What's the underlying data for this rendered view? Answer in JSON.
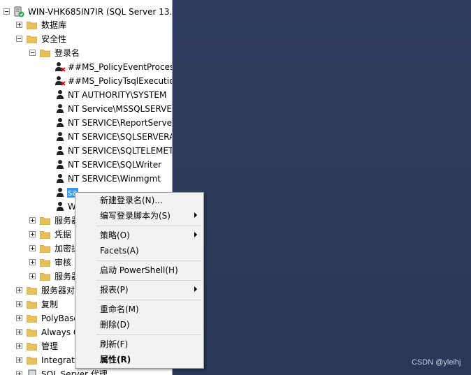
{
  "tree": {
    "server_label": "WIN-VHK685IN7IR (SQL Server 13.",
    "nodes": {
      "databases": "数据库",
      "security": "安全性",
      "logins": "登录名",
      "server_roles": "服务器",
      "credentials": "凭据",
      "crypto": "加密提",
      "audits": "审核",
      "server_audit_specs": "服务器",
      "server_objects": "服务器对",
      "replication": "复制",
      "polybase": "PolyBase",
      "always_on": "Always C",
      "management": "管理",
      "integration": "Integratio",
      "sql_agent": "SQL Server 代理"
    },
    "logins": [
      {
        "name": "##MS_PolicyEventProcess",
        "disabled": true
      },
      {
        "name": "##MS_PolicyTsqlExecution",
        "disabled": true
      },
      {
        "name": "NT AUTHORITY\\SYSTEM",
        "disabled": false
      },
      {
        "name": "NT Service\\MSSQLSERVE",
        "disabled": false
      },
      {
        "name": "NT SERVICE\\ReportServe",
        "disabled": false
      },
      {
        "name": "NT SERVICE\\SQLSERVERA",
        "disabled": false
      },
      {
        "name": "NT SERVICE\\SQLTELEMET",
        "disabled": false
      },
      {
        "name": "NT SERVICE\\SQLWriter",
        "disabled": false
      },
      {
        "name": "NT SERVICE\\Winmgmt",
        "disabled": false
      },
      {
        "name": "sa",
        "disabled": false,
        "selected": true
      },
      {
        "name": "W",
        "disabled": false
      }
    ]
  },
  "context_menu": {
    "new_login": "新建登录名(N)...",
    "script_login_as": "编写登录脚本为(S)",
    "policies": "策略(O)",
    "facets": "Facets(A)",
    "start_powershell": "启动 PowerShell(H)",
    "reports": "报表(P)",
    "rename": "重命名(M)",
    "delete": "删除(D)",
    "refresh": "刷新(F)",
    "properties": "属性(R)"
  },
  "watermark": "CSDN @yleihj",
  "colors": {
    "workspace": "#2d3b5c",
    "selection": "#3399ff",
    "folder": "#e8c15b",
    "disabled_mark": "#cc0000"
  }
}
